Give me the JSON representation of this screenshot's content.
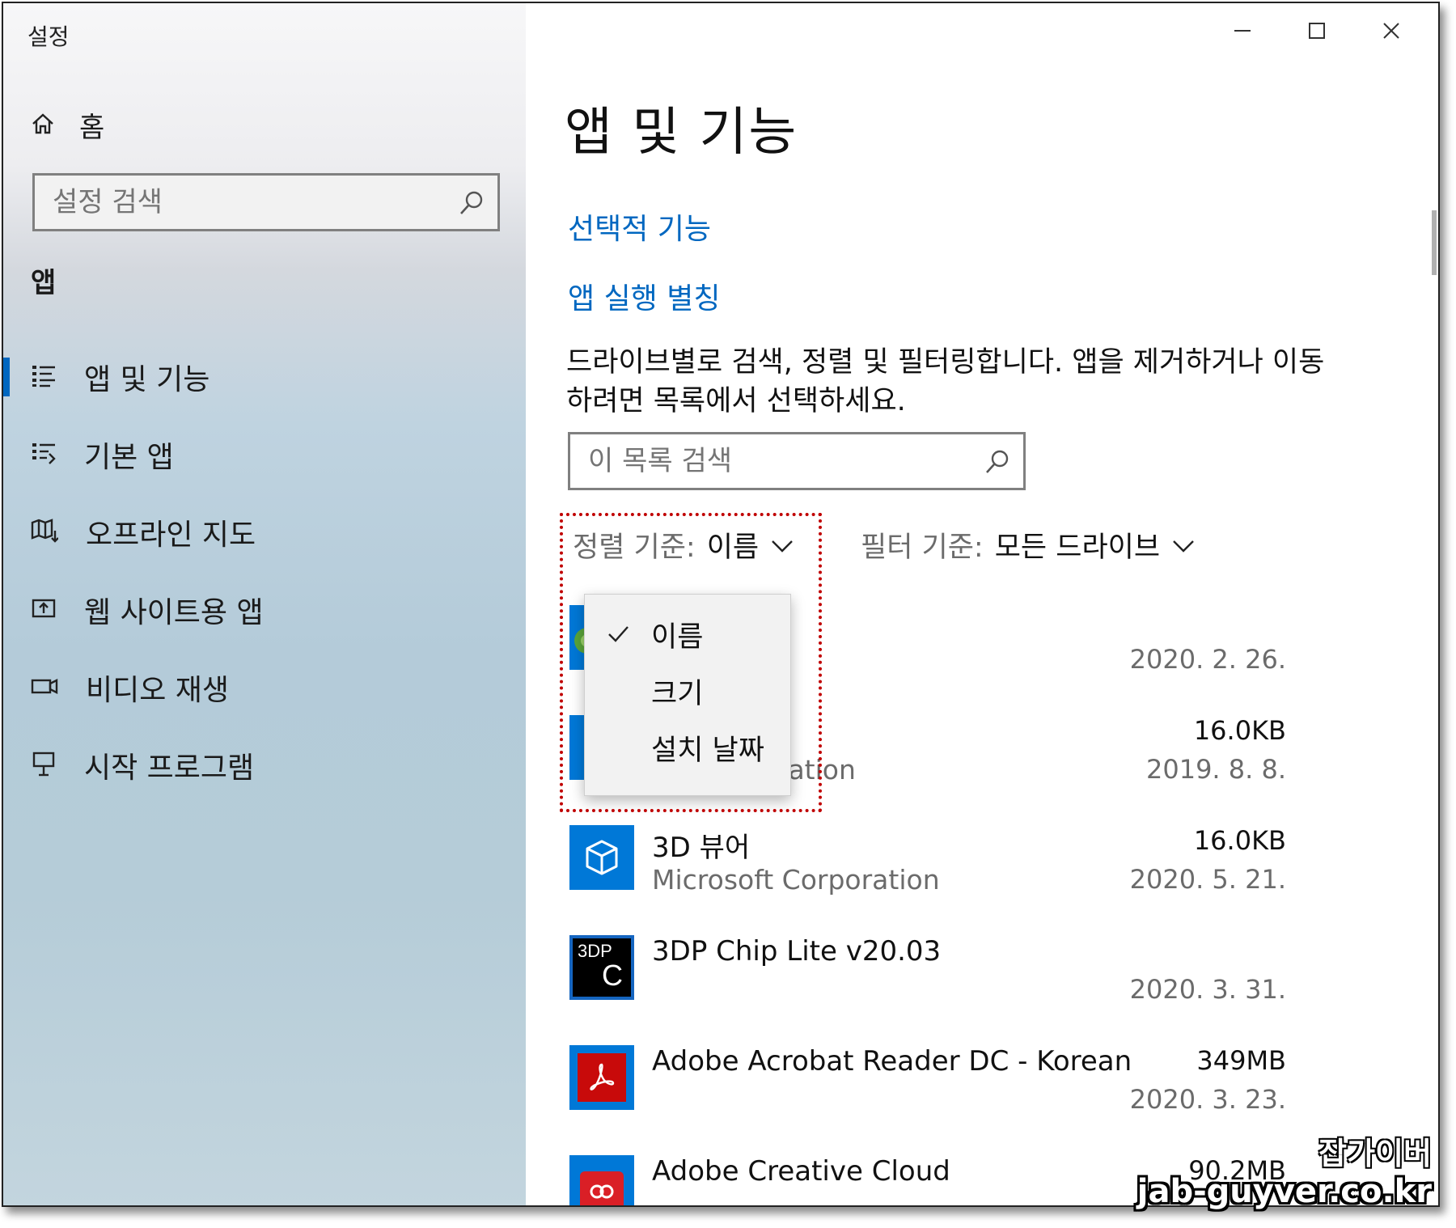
{
  "window": {
    "title": "설정"
  },
  "sidebar": {
    "home_label": "홈",
    "search_placeholder": "설정 검색",
    "section_label": "앱",
    "items": [
      {
        "label": "앱 및 기능",
        "icon": "apps-features-icon",
        "active": true
      },
      {
        "label": "기본 앱",
        "icon": "default-apps-icon",
        "active": false
      },
      {
        "label": "오프라인 지도",
        "icon": "offline-maps-icon",
        "active": false
      },
      {
        "label": "웹 사이트용 앱",
        "icon": "apps-for-websites-icon",
        "active": false
      },
      {
        "label": "비디오 재생",
        "icon": "video-playback-icon",
        "active": false
      },
      {
        "label": "시작 프로그램",
        "icon": "startup-icon",
        "active": false
      }
    ]
  },
  "main": {
    "title": "앱 및 기능",
    "links": {
      "optional_features": "선택적 기능",
      "app_aliases": "앱 실행 별칭"
    },
    "description": "드라이브별로 검색, 정렬 및 필터링합니다. 앱을 제거하거나 이동하려면 목록에서 선택하세요.",
    "list_search_placeholder": "이 목록 검색",
    "sort": {
      "label": "정렬 기준:",
      "value": "이름"
    },
    "filter": {
      "label": "필터 기준:",
      "value": "모든 드라이브"
    },
    "sort_options": [
      {
        "label": "이름",
        "selected": true
      },
      {
        "label": "크기",
        "selected": false
      },
      {
        "label": "설치 날짜",
        "selected": false
      }
    ],
    "apps": [
      {
        "name": "",
        "publisher": "",
        "size": "",
        "date": "2020. 2. 26."
      },
      {
        "name": "",
        "publisher": "orporation",
        "size": "16.0KB",
        "date": "2019. 8. 8."
      },
      {
        "name": "3D 뷰어",
        "publisher": "Microsoft Corporation",
        "size": "16.0KB",
        "date": "2020. 5. 21."
      },
      {
        "name": "3DP Chip Lite v20.03",
        "publisher": "",
        "size": "",
        "date": "2020. 3. 31.",
        "icon_text_top": "3DP",
        "icon_text_bottom": "C"
      },
      {
        "name": "Adobe Acrobat Reader DC - Korean",
        "publisher": "",
        "size": "349MB",
        "date": "2020. 3. 23."
      },
      {
        "name": "Adobe Creative Cloud",
        "publisher": "",
        "size": "90.2MB",
        "date": ""
      }
    ]
  },
  "watermark": {
    "line1": "잡가이버",
    "line2": "jab-guyver.co.kr"
  },
  "colors": {
    "accent": "#0067c0",
    "highlight_border": "#c00000",
    "tile_blue": "#0078d7",
    "acrobat_red": "#c80a0a"
  }
}
